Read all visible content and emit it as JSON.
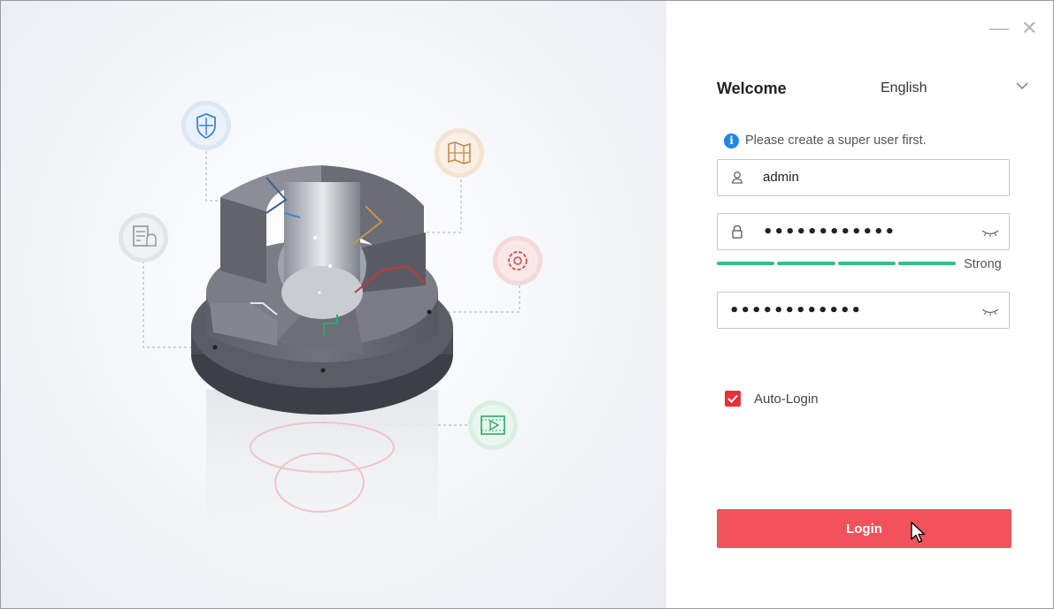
{
  "window": {
    "minimize_label": "—",
    "close_label": "✕"
  },
  "login_panel": {
    "welcome_title": "Welcome",
    "language": {
      "selected": "English",
      "icon": "chevron-down-icon"
    },
    "hint": {
      "icon": "info-icon",
      "icon_glyph": "i",
      "text": "Please create a super user first."
    },
    "username": {
      "icon": "user-icon",
      "value": "admin"
    },
    "password": {
      "icon": "lock-icon",
      "masked_value": "••••••••••••",
      "toggle_icon": "eye-closed-icon"
    },
    "password_strength": {
      "segments_filled": 4,
      "segments_total": 4,
      "label": "Strong",
      "color": "#2fc282"
    },
    "confirm_password": {
      "masked_value": "••••••••••••",
      "toggle_icon": "eye-closed-icon"
    },
    "auto_login": {
      "label": "Auto-Login",
      "checked": true
    },
    "login_button": {
      "label": "Login",
      "color": "#f2535a"
    }
  },
  "hero_icons": [
    "shield-icon",
    "map-icon",
    "alarm-list-icon",
    "settings-gear-icon",
    "video-play-icon"
  ],
  "colors": {
    "accent_red": "#e8303b",
    "strength_green": "#2fc282",
    "info_blue": "#1e88e5"
  }
}
